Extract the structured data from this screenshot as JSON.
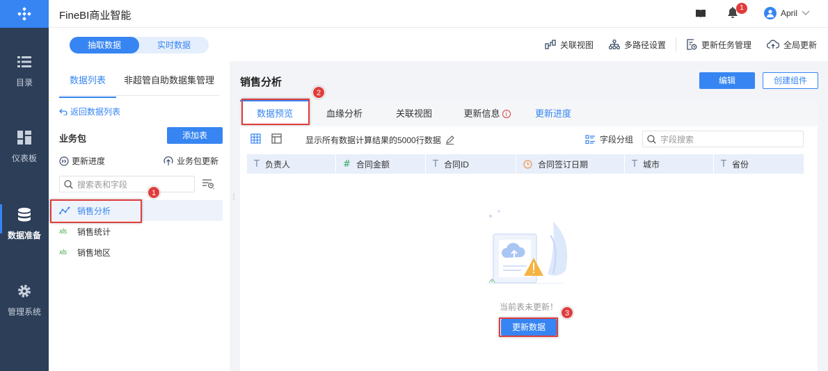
{
  "app": {
    "title": "FineBI商业智能"
  },
  "nav": {
    "items": [
      {
        "label": "目录",
        "icon": "list-icon"
      },
      {
        "label": "仪表板",
        "icon": "dashboard-icon"
      },
      {
        "label": "数据准备",
        "icon": "database-icon"
      },
      {
        "label": "管理系统",
        "icon": "gear-icon"
      }
    ],
    "active": "数据准备"
  },
  "header": {
    "notification_count": "1",
    "user_name": "April"
  },
  "toolbar": {
    "mode_tabs": [
      "抽取数据",
      "实时数据"
    ],
    "actions": [
      "关联视图",
      "多路径设置",
      "更新任务管理",
      "全局更新"
    ]
  },
  "left_panel": {
    "tabs": [
      "数据列表",
      "非超管自助数据集管理"
    ],
    "back_link": "返回数据列表",
    "package_title": "业务包",
    "add_table": "添加表",
    "update_progress": "更新进度",
    "package_update": "业务包更新",
    "search_placeholder": "搜索表和字段",
    "tables": [
      {
        "name": "销售分析",
        "type": "analysis"
      },
      {
        "name": "销售统计",
        "type": "xls"
      },
      {
        "name": "销售地区",
        "type": "xls"
      }
    ],
    "xls_label": "xls"
  },
  "main": {
    "title": "销售分析",
    "edit_button": "编辑",
    "create_button": "创建组件",
    "tabs": [
      "数据预览",
      "血缘分析",
      "关联视图",
      "更新信息",
      "更新进度"
    ],
    "preview_note": "显示所有数据计算结果的5000行数据",
    "field_group": "字段分组",
    "field_search_placeholder": "字段搜索",
    "columns": [
      {
        "type_symbol": "T",
        "name": "负责人"
      },
      {
        "type_symbol": "#",
        "name": "合同金额"
      },
      {
        "type_symbol": "T",
        "name": "合同ID"
      },
      {
        "type_symbol": "clock",
        "name": "合同签订日期"
      },
      {
        "type_symbol": "T",
        "name": "城市"
      },
      {
        "type_symbol": "T",
        "name": "省份"
      }
    ],
    "empty_text": "当前表未更新！",
    "update_button": "更新数据"
  },
  "callouts": [
    "1",
    "2",
    "3"
  ],
  "colors": {
    "accent": "#3685f2",
    "nav_bg": "#2c3e58",
    "callout": "#e03c3c"
  }
}
